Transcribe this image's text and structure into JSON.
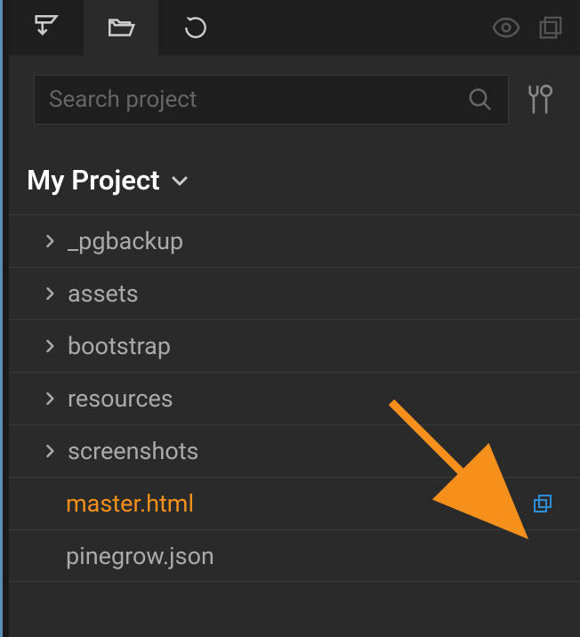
{
  "search": {
    "placeholder": "Search project"
  },
  "project": {
    "title": "My Project"
  },
  "tree": {
    "items": [
      {
        "label": "_pgbackup",
        "type": "folder"
      },
      {
        "label": "assets",
        "type": "folder"
      },
      {
        "label": "bootstrap",
        "type": "folder"
      },
      {
        "label": "resources",
        "type": "folder"
      },
      {
        "label": "screenshots",
        "type": "folder"
      },
      {
        "label": "master.html",
        "type": "file",
        "selected": true,
        "action": "open-duplicate"
      },
      {
        "label": "pinegrow.json",
        "type": "file"
      }
    ]
  }
}
